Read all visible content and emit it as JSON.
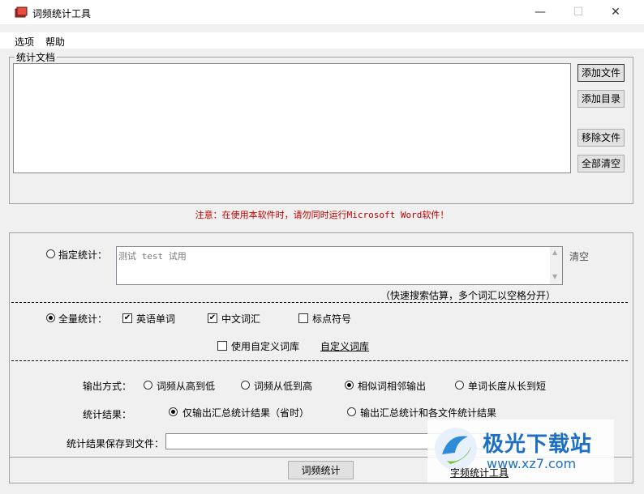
{
  "window": {
    "title": "词频统计工具",
    "minimize": "—",
    "maximize": "☐",
    "close": "✕"
  },
  "menu": {
    "items": [
      "选项",
      "帮助"
    ]
  },
  "documents": {
    "group_label": "统计文档",
    "add_file": "添加文件",
    "add_dir": "添加目录",
    "remove_file": "移除文件",
    "clear_all": "全部清空"
  },
  "notice": "注意：在使用本软件时，请勿同时运行Microsoft Word软件！",
  "specified": {
    "label": "指定统计：",
    "text": "测试 test 试用",
    "clear": "清空",
    "hint": "（快速搜索估算，多个词汇以空格分开）",
    "selected": false
  },
  "full": {
    "label": "全量统计：",
    "selected": true,
    "english_words": {
      "label": "英语单词",
      "checked": true
    },
    "chinese_words": {
      "label": "中文词汇",
      "checked": true
    },
    "punctuation": {
      "label": "标点符号",
      "checked": false
    },
    "custom_dict": {
      "label": "使用自定义词库",
      "checked": false
    },
    "custom_dict_link": "自定义词库"
  },
  "output": {
    "mode_label": "输出方式：",
    "modes": [
      {
        "label": "词频从高到低",
        "selected": false
      },
      {
        "label": "词频从低到高",
        "selected": false
      },
      {
        "label": "相似词相邻输出",
        "selected": true
      },
      {
        "label": "单词长度从长到短",
        "selected": false
      }
    ],
    "result_label": "统计结果：",
    "results": [
      {
        "label": "仅输出汇总统计结果（省时）",
        "selected": true
      },
      {
        "label": "输出汇总统计和各文件统计结果",
        "selected": false
      }
    ],
    "save_label": "统计结果保存到文件：",
    "save_value": ""
  },
  "footer": {
    "run": "词频统计",
    "char_tool_link": "字频统计工具"
  },
  "watermark": {
    "name": "极光下载站",
    "url": "www.xz7.com"
  },
  "colors": {
    "notice": "#c00000",
    "watermark": "#1d6fc4"
  }
}
